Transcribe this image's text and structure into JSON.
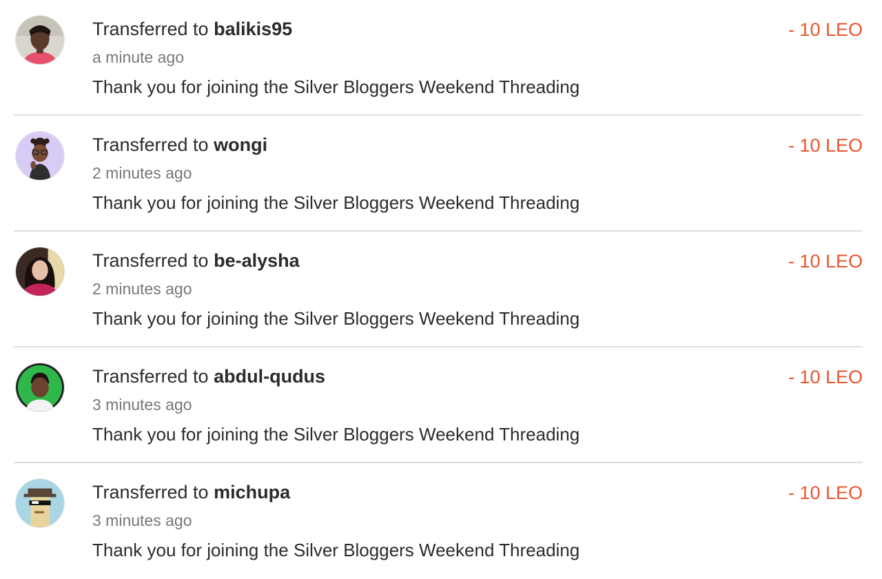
{
  "transactions": [
    {
      "title_prefix": "Transferred to",
      "username": "balikis95",
      "time": "a minute ago",
      "memo": "Thank you for joining the Silver Bloggers Weekend Threading",
      "amount": "- 10 LEO"
    },
    {
      "title_prefix": "Transferred to",
      "username": "wongi",
      "time": "2 minutes ago",
      "memo": "Thank you for joining the Silver Bloggers Weekend Threading",
      "amount": "- 10 LEO"
    },
    {
      "title_prefix": "Transferred to",
      "username": "be-alysha",
      "time": "2 minutes ago",
      "memo": "Thank you for joining the Silver Bloggers Weekend Threading",
      "amount": "- 10 LEO"
    },
    {
      "title_prefix": "Transferred to",
      "username": "abdul-qudus",
      "time": "3 minutes ago",
      "memo": "Thank you for joining the Silver Bloggers Weekend Threading",
      "amount": "- 10 LEO"
    },
    {
      "title_prefix": "Transferred to",
      "username": "michupa",
      "time": "3 minutes ago",
      "memo": "Thank you for joining the Silver Bloggers Weekend Threading",
      "amount": "- 10 LEO"
    }
  ],
  "colors": {
    "amount": "#e8542d",
    "divider": "#dedede",
    "title": "#2b2b2b",
    "time": "#777777"
  },
  "icons": {
    "avatar": "user-avatar-photo"
  }
}
